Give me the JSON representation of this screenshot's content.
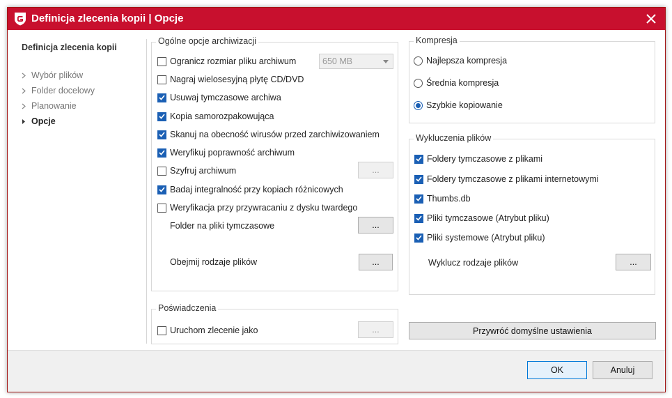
{
  "window": {
    "title": "Definicja zlecenia kopii | Opcje"
  },
  "sidebar": {
    "title": "Definicja zlecenia kopii",
    "items": [
      {
        "label": "Wybór plików",
        "active": false
      },
      {
        "label": "Folder docelowy",
        "active": false
      },
      {
        "label": "Planowanie",
        "active": false
      },
      {
        "label": "Opcje",
        "active": true
      }
    ]
  },
  "general": {
    "label": "Ogólne opcje archiwizacji",
    "options": [
      {
        "label": "Ogranicz rozmiar pliku archiwum",
        "checked": false
      },
      {
        "label": "Nagraj wielosesyjną płytę CD/DVD",
        "checked": false
      },
      {
        "label": "Usuwaj tymczasowe archiwa",
        "checked": true
      },
      {
        "label": "Kopia samorozpakowująca",
        "checked": true
      },
      {
        "label": "Skanuj na obecność wirusów przed zarchiwizowaniem",
        "checked": true
      },
      {
        "label": "Weryfikuj poprawność archiwum",
        "checked": true
      },
      {
        "label": "Szyfruj archiwum",
        "checked": false
      },
      {
        "label": "Badaj integralność przy kopiach różnicowych",
        "checked": true
      },
      {
        "label": "Weryfikacja przy przywracaniu z dysku twardego",
        "checked": false
      }
    ],
    "size_select": "650 MB",
    "temp_folder_label": "Folder na pliki tymczasowe",
    "include_types_label": "Obejmij rodzaje plików",
    "ellipsis": "..."
  },
  "credentials": {
    "label": "Poświadczenia",
    "run_as": {
      "label": "Uruchom zlecenie jako",
      "checked": false
    }
  },
  "compression": {
    "label": "Kompresja",
    "options": [
      {
        "label": "Najlepsza kompresja",
        "selected": false
      },
      {
        "label": "Średnia kompresja",
        "selected": false
      },
      {
        "label": "Szybkie kopiowanie",
        "selected": true
      }
    ]
  },
  "exclusions": {
    "label": "Wykluczenia plików",
    "options": [
      {
        "label": "Foldery tymczasowe z plikami",
        "checked": true
      },
      {
        "label": "Foldery tymczasowe z plikami internetowymi",
        "checked": true
      },
      {
        "label": "Thumbs.db",
        "checked": true
      },
      {
        "label": "Pliki tymczasowe (Atrybut pliku)",
        "checked": true
      },
      {
        "label": "Pliki systemowe (Atrybut pliku)",
        "checked": true
      }
    ],
    "exclude_types_label": "Wyklucz rodzaje plików"
  },
  "restore_defaults": "Przywróć domyślne ustawienia",
  "footer": {
    "ok": "OK",
    "cancel": "Anuluj"
  },
  "colors": {
    "titlebar": "#c8102e",
    "checkbox": "#1a5fb4"
  }
}
